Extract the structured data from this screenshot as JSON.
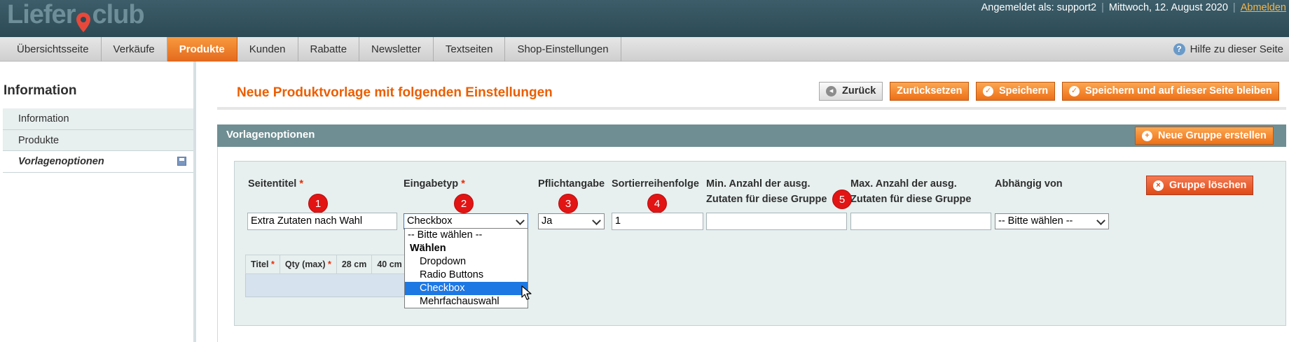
{
  "header": {
    "logo_left": "Liefer",
    "logo_right": "club",
    "logged_in_as": "Angemeldet als: support2",
    "date": "Mittwoch, 12. August 2020",
    "logout": "Abmelden",
    "separator": "|"
  },
  "nav": {
    "items": [
      {
        "label": "Übersichtsseite"
      },
      {
        "label": "Verkäufe"
      },
      {
        "label": "Produkte"
      },
      {
        "label": "Kunden"
      },
      {
        "label": "Rabatte"
      },
      {
        "label": "Newsletter"
      },
      {
        "label": "Textseiten"
      },
      {
        "label": "Shop-Einstellungen"
      }
    ],
    "active_index": 2,
    "help": "Hilfe zu dieser Seite",
    "help_icon": "?"
  },
  "sidebar": {
    "title": "Information",
    "items": [
      {
        "label": "Information"
      },
      {
        "label": "Produkte"
      },
      {
        "label": "Vorlagenoptionen"
      }
    ]
  },
  "main": {
    "title": "Neue Produktvorlage mit folgenden Einstellungen",
    "buttons": {
      "back": "Zurück",
      "reset": "Zurücksetzen",
      "save": "Speichern",
      "save_stay": "Speichern und auf dieser Seite bleiben"
    },
    "icons": {
      "back": "◂",
      "save": "✓",
      "add": "+",
      "delete": "×"
    },
    "section": {
      "title": "Vorlagenoptionen",
      "new_group": "Neue Gruppe erstellen",
      "delete_group": "Gruppe löschen"
    },
    "columns": {
      "page_title": "Seitentitel",
      "input_type": "Eingabetyp",
      "required": "Pflichtangabe",
      "sort_order": "Sortierreihenfolge",
      "min_line1": "Min. Anzahl der ausg.",
      "min_line2": "Zutaten für diese Gruppe",
      "max_line1": "Max. Anzahl der ausg.",
      "max_line2": "Zutaten für diese Gruppe",
      "depends_on": "Abhängig von",
      "required_mark": "*"
    },
    "badges": [
      "1",
      "2",
      "3",
      "4",
      "5"
    ],
    "fields": {
      "page_title_value": "Extra Zutaten nach Wahl",
      "input_type_value": "Checkbox",
      "required_value": "Ja",
      "sort_order_value": "1",
      "min_value": "",
      "max_value": "",
      "depends_on_value": "-- Bitte wählen --"
    },
    "dropdown": {
      "options": [
        {
          "label": "-- Bitte wählen --",
          "kind": "plain"
        },
        {
          "label": "Wählen",
          "kind": "group"
        },
        {
          "label": "Dropdown",
          "kind": "child"
        },
        {
          "label": "Radio Buttons",
          "kind": "child"
        },
        {
          "label": "Checkbox",
          "kind": "child",
          "selected": true
        },
        {
          "label": "Mehrfachauswahl",
          "kind": "child"
        }
      ]
    },
    "subgrid": {
      "headers": [
        "Titel",
        "Qty (max)",
        "28 cm",
        "40 cm"
      ],
      "required_mark": "*"
    }
  },
  "colors": {
    "header_bg": "#2c4a56",
    "accent_orange": "#eb5e00",
    "section_head": "#6f8e93",
    "badge_red": "#e21414",
    "selection_blue": "#1e78e3"
  }
}
